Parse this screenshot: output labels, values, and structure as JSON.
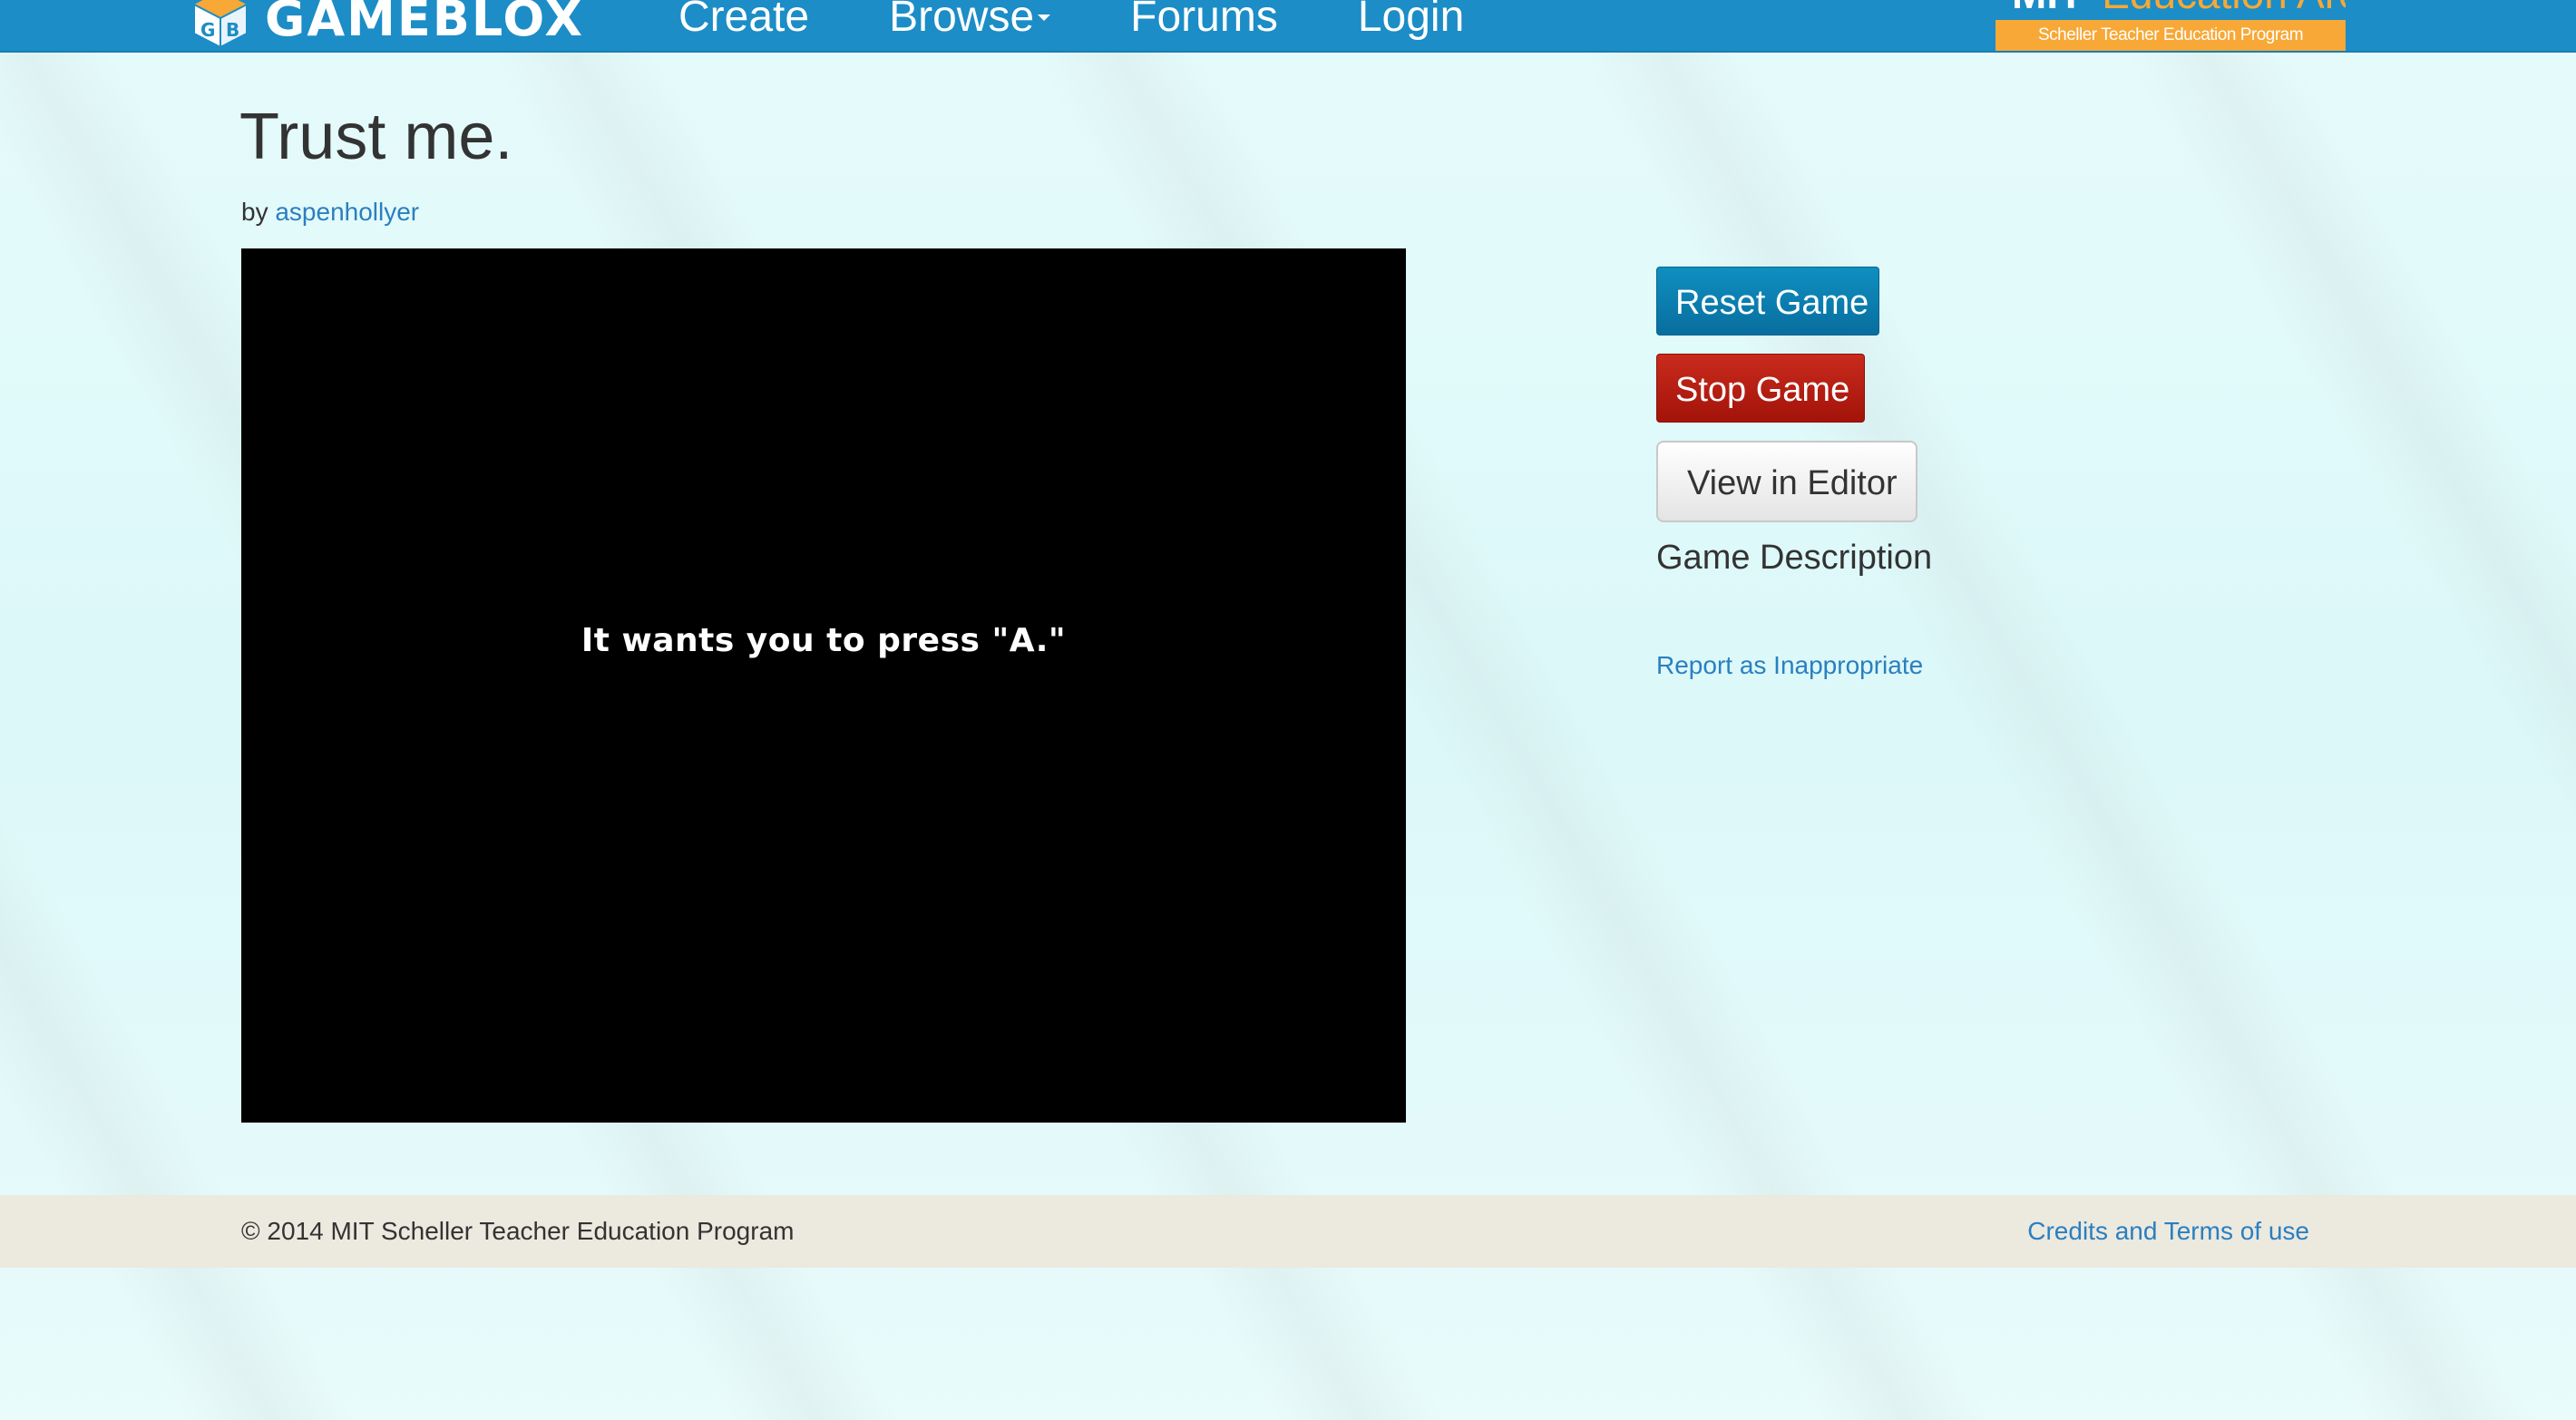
{
  "navbar": {
    "logo_text": "GAMEBLOX",
    "links": [
      {
        "label": "Create"
      },
      {
        "label": "Browse"
      },
      {
        "label": "Forums"
      },
      {
        "label": "Login"
      }
    ],
    "partner_logo": {
      "top_text_mit": "MIT",
      "top_text": "Education Arcade",
      "bottom_text": "Scheller Teacher Education Program"
    },
    "colors": {
      "bar": "#1c8dc6",
      "accent": "#f7a836"
    }
  },
  "game": {
    "title": "Trust me.",
    "by_label": "by",
    "author": "aspenhollyer",
    "canvas_text": "It wants you to press \"A.\""
  },
  "sidebar": {
    "reset_label": "Reset Game",
    "stop_label": "Stop Game",
    "editor_label": "View in Editor",
    "description_heading": "Game Description",
    "report_label": "Report as Inappropriate"
  },
  "footer": {
    "copyright": "© 2014 MIT Scheller Teacher Education Program",
    "credits_label": "Credits and Terms of use"
  }
}
